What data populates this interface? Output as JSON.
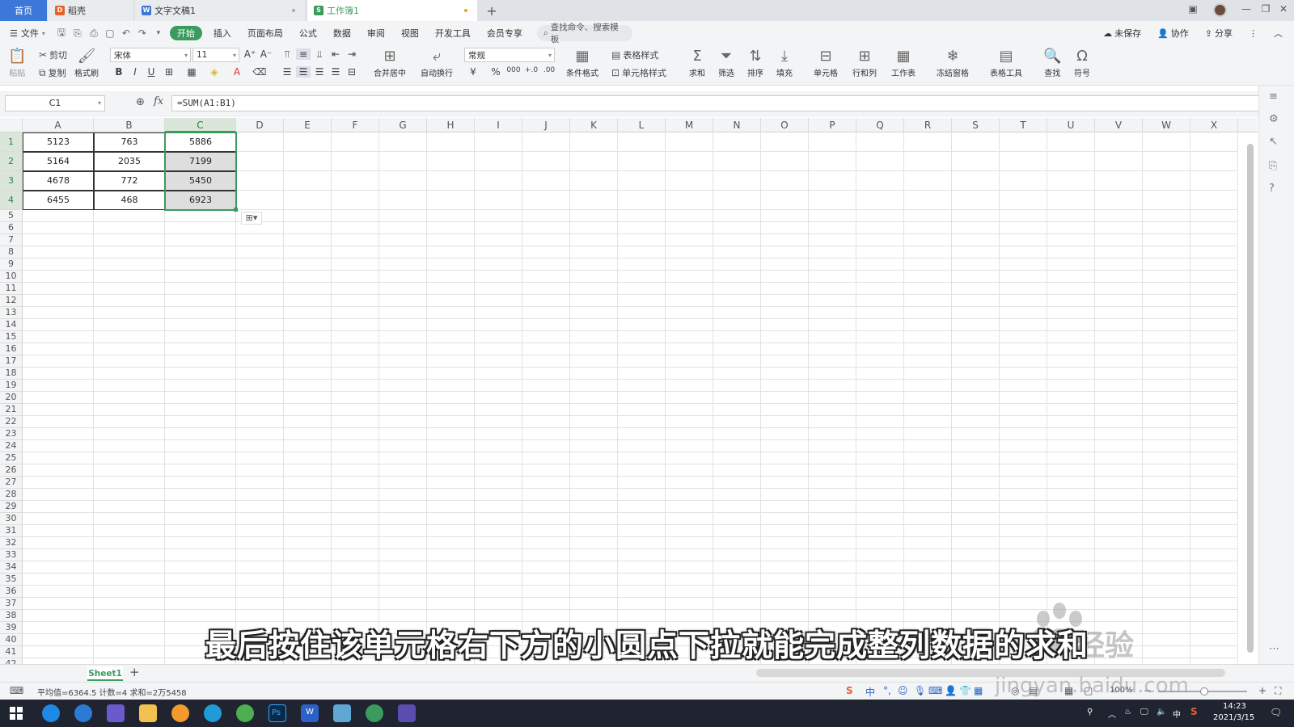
{
  "tabs": {
    "home": "首页",
    "docer": "稻壳",
    "doc": "文字文稿1",
    "sheet": "工作簿1",
    "add": "+"
  },
  "menu": {
    "file": "文件",
    "items": [
      "开始",
      "插入",
      "页面布局",
      "公式",
      "数据",
      "审阅",
      "视图",
      "开发工具",
      "会员专享"
    ],
    "search_placeholder": "查找命令、搜索模板",
    "unsaved": "未保存",
    "collab": "协作",
    "share": "分享"
  },
  "ribbon": {
    "paste": "粘贴",
    "cut": "剪切",
    "copy": "复制",
    "format_painter": "格式刷",
    "font_name": "宋体",
    "font_size": "11",
    "merge_center": "合并居中",
    "wrap_text": "自动换行",
    "number_format": "常规",
    "cond_format": "条件格式",
    "table_style": "表格样式",
    "cell_style": "单元格样式",
    "sum": "求和",
    "filter": "筛选",
    "sort": "排序",
    "fill": "填充",
    "cell": "单元格",
    "rowcol": "行和列",
    "worksheet": "工作表",
    "freeze": "冻结窗格",
    "table_tools": "表格工具",
    "find": "查找",
    "symbol": "符号"
  },
  "formula_bar": {
    "name_box": "C1",
    "fx": "fx",
    "formula": "=SUM(A1:B1)"
  },
  "grid": {
    "columns": [
      "A",
      "B",
      "C",
      "D",
      "E",
      "F",
      "G",
      "H",
      "I",
      "J",
      "K",
      "L",
      "M",
      "N",
      "O",
      "P",
      "Q",
      "R",
      "S",
      "T",
      "U",
      "V",
      "W",
      "X"
    ],
    "rows": [
      "1",
      "2",
      "3",
      "4",
      "5",
      "6",
      "7",
      "8",
      "9",
      "10",
      "11",
      "12",
      "13",
      "14",
      "15",
      "16",
      "17",
      "18",
      "19",
      "20",
      "21",
      "22",
      "23",
      "24",
      "25",
      "26",
      "27",
      "28",
      "29",
      "30",
      "31",
      "32",
      "33",
      "34",
      "35",
      "36",
      "37",
      "38",
      "39",
      "40",
      "41",
      "42"
    ],
    "data": [
      [
        "5123",
        "763",
        "5886"
      ],
      [
        "5164",
        "2035",
        "7199"
      ],
      [
        "4678",
        "772",
        "5450"
      ],
      [
        "6455",
        "468",
        "6923"
      ]
    ]
  },
  "sheets": [
    "Sheet1"
  ],
  "status": {
    "summary": "平均值=6364.5  计数=4  求和=2万5458",
    "zoom": "100%"
  },
  "subtitle": "最后按住该单元格右下方的小圆点下拉就能完成整列数据的求和",
  "watermark": {
    "brand": "经验",
    "url": "jingyan.baidu.com"
  },
  "taskbar": {
    "time": "14:23",
    "date": "2021/3/15",
    "ime": "中"
  },
  "colors": {
    "accent": "#3a9b5d",
    "home_tab": "#3c78d8",
    "taskbar": "#1f2430"
  }
}
